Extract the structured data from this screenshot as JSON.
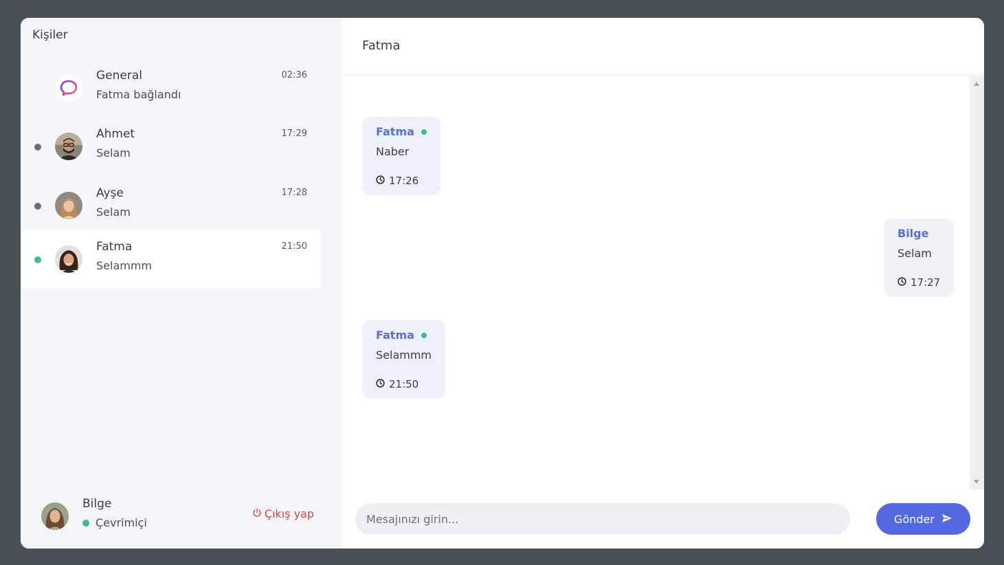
{
  "sidebar": {
    "title": "Kişiler",
    "contacts": [
      {
        "name": "General",
        "last_message": "Fatma bağlandı",
        "time": "02:36",
        "status": "none",
        "avatar": "chat-bubble-logo"
      },
      {
        "name": "Ahmet",
        "last_message": "Selam",
        "time": "17:29",
        "status": "offline",
        "avatar": "user-photo"
      },
      {
        "name": "Ayşe",
        "last_message": "Selam",
        "time": "17:28",
        "status": "offline",
        "avatar": "user-photo"
      },
      {
        "name": "Fatma",
        "last_message": "Selammm",
        "time": "21:50",
        "status": "online",
        "avatar": "user-photo",
        "active": true
      }
    ],
    "me": {
      "name": "Bilge",
      "status": "Çevrimiçi",
      "logout_label": "Çıkış yap"
    }
  },
  "chat": {
    "title": "Fatma",
    "messages": [
      {
        "author": "Fatma",
        "text": "Naber",
        "time": "17:26",
        "online": true,
        "mine": false
      },
      {
        "author": "Bilge",
        "text": "Selam",
        "time": "17:27",
        "online": false,
        "mine": true
      },
      {
        "author": "Fatma",
        "text": "Selammm",
        "time": "21:50",
        "online": true,
        "mine": false
      }
    ],
    "composer": {
      "placeholder": "Mesajınızı girin...",
      "send_label": "Gönder"
    }
  },
  "colors": {
    "accent": "#5468e0",
    "online": "#3bbf86",
    "logout": "#d9434e",
    "background": "#4a5058"
  }
}
